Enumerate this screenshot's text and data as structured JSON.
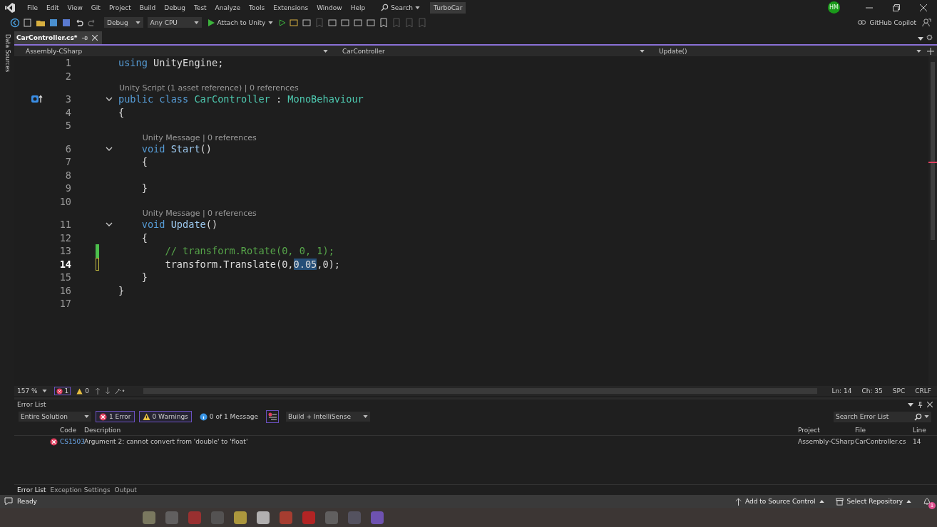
{
  "menu": {
    "items": [
      "File",
      "Edit",
      "View",
      "Git",
      "Project",
      "Build",
      "Debug",
      "Test",
      "Analyze",
      "Tools",
      "Extensions",
      "Window",
      "Help"
    ],
    "search": "Search",
    "solution": "TurboCar",
    "avatar": "HM"
  },
  "toolbar": {
    "configuration": "Debug",
    "platform": "Any CPU",
    "run_label": "Attach to Unity",
    "copilot": "GitHub Copilot"
  },
  "side_panel": {
    "label": "Data Sources"
  },
  "tabs": [
    {
      "label": "CarController.cs*",
      "selected": true
    }
  ],
  "nav_bar": {
    "project": "Assembly-CSharp",
    "type": "CarController",
    "member": "Update()"
  },
  "code": {
    "lines": [
      {
        "number": "1",
        "current": false,
        "tokens": [
          {
            "kind": "keyword",
            "text": "using"
          },
          {
            "kind": "plain",
            "text": " UnityEngine;"
          }
        ]
      },
      {
        "number": "2",
        "current": false
      },
      {
        "number": "3",
        "current": false,
        "lens": "Unity Script (1 asset reference) | 0 references",
        "expanded": true,
        "unity_marker": true,
        "tokens": [
          {
            "kind": "keyword",
            "text": "public class"
          },
          {
            "kind": "type",
            "text": " CarController"
          },
          {
            "kind": "plain",
            "text": " : "
          },
          {
            "kind": "type",
            "text": "MonoBehaviour"
          }
        ]
      },
      {
        "number": "4",
        "current": false,
        "tokens": [
          {
            "kind": "plain",
            "text": "{"
          }
        ]
      },
      {
        "number": "5",
        "current": false
      },
      {
        "number": "6",
        "current": false,
        "lens": "Unity Message | 0 references",
        "expanded": true,
        "tokens": [
          {
            "kind": "keyword",
            "text": "    void"
          },
          {
            "kind": "method",
            "text": " Start"
          },
          {
            "kind": "plain",
            "text": "()"
          }
        ]
      },
      {
        "number": "7",
        "current": false,
        "tokens": [
          {
            "kind": "plain",
            "text": "    {"
          }
        ]
      },
      {
        "number": "8",
        "current": false
      },
      {
        "number": "9",
        "current": false,
        "tokens": [
          {
            "kind": "plain",
            "text": "    }"
          }
        ]
      },
      {
        "number": "10",
        "current": false
      },
      {
        "number": "11",
        "current": false,
        "lens": "Unity Message | 0 references",
        "expanded": true,
        "tokens": [
          {
            "kind": "keyword",
            "text": "    void"
          },
          {
            "kind": "method",
            "text": " Update"
          },
          {
            "kind": "plain",
            "text": "()"
          }
        ]
      },
      {
        "number": "12",
        "current": false,
        "tokens": [
          {
            "kind": "plain",
            "text": "    {"
          }
        ]
      },
      {
        "number": "13",
        "current": false,
        "change_saved": true,
        "tokens": [
          {
            "kind": "comment",
            "text": "        // transform.Rotate(0, 0, 1);"
          }
        ]
      },
      {
        "number": "14",
        "current": true,
        "change_saved": false,
        "tokens": [
          {
            "kind": "plain",
            "text": "        transform.Translate(0,"
          },
          {
            "kind": "selected",
            "text": "0.05"
          },
          {
            "kind": "plain",
            "text": ",0);"
          }
        ]
      },
      {
        "number": "15",
        "current": false,
        "tokens": [
          {
            "kind": "plain",
            "text": "    }"
          }
        ]
      },
      {
        "number": "16",
        "current": false,
        "tokens": [
          {
            "kind": "plain",
            "text": "}"
          }
        ]
      },
      {
        "number": "17",
        "current": false
      }
    ]
  },
  "editor_status": {
    "zoom": "157 %",
    "errors": "1",
    "warnings": "0",
    "line": "Ln: 14",
    "column": "Ch: 35",
    "whitespace": "SPC",
    "line_ending": "CRLF"
  },
  "error_list": {
    "title": "Error List",
    "scope": "Entire Solution",
    "filters": [
      {
        "kind": "error",
        "label": "1 Error",
        "selected": true
      },
      {
        "kind": "warning",
        "label": "0 Warnings",
        "selected": true
      },
      {
        "kind": "message",
        "label": "0 of 1 Message",
        "selected": false
      }
    ],
    "source": "Build + IntelliSense",
    "search": {
      "placeholder": "Search Error List"
    },
    "columns": [
      "Code",
      "Description",
      "Project",
      "File",
      "Line"
    ],
    "rows": [
      {
        "kind": "error",
        "cells": [
          "CS1503",
          "Argument 2: cannot convert from 'double' to 'float'",
          "Assembly-CSharp",
          "CarController.cs",
          "14"
        ]
      }
    ]
  },
  "bottom_tabs": [
    {
      "label": "Error List",
      "selected": true
    },
    {
      "label": "Exception Settings",
      "selected": false
    },
    {
      "label": "Output",
      "selected": false
    }
  ],
  "status_bar": {
    "text": "Ready",
    "source_control": "Add to Source Control",
    "repository": "Select Repository",
    "notifications": "1"
  }
}
